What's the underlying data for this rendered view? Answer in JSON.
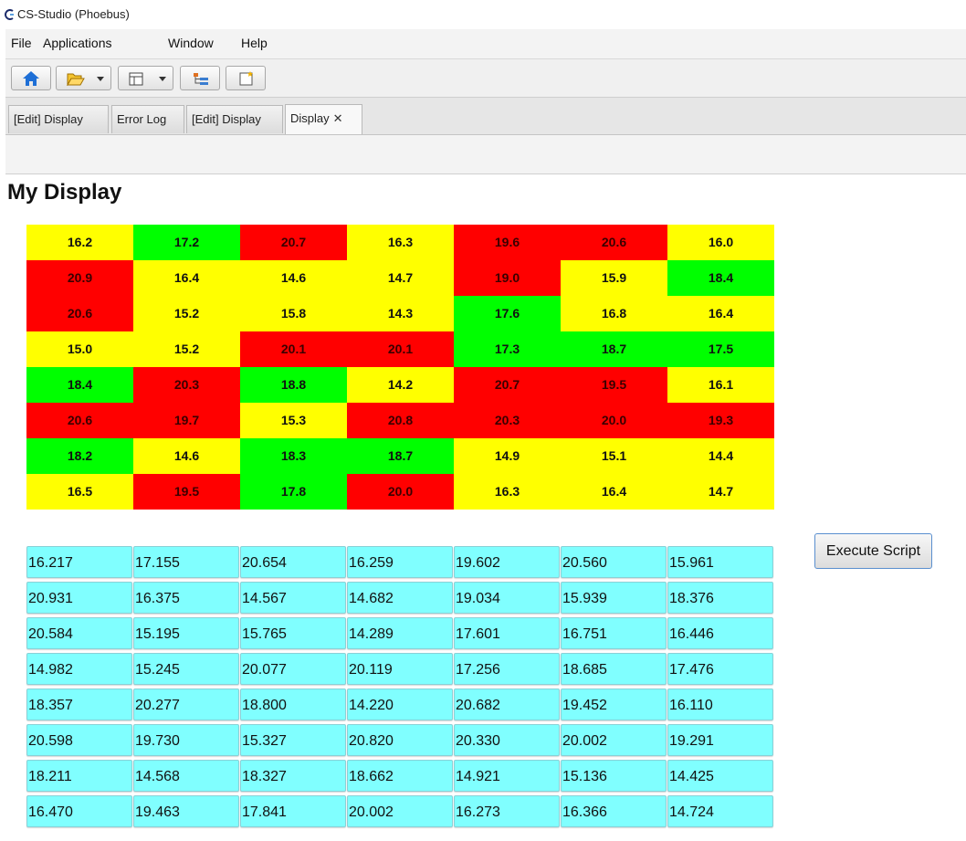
{
  "window": {
    "title": "CS-Studio (Phoebus)"
  },
  "menu": [
    "File",
    "Applications",
    "Window",
    "Help"
  ],
  "toolbar": {
    "buttons": [
      "home-icon",
      "open-folder-icon",
      "layout-icon",
      "tree-icon",
      "new-display-icon"
    ]
  },
  "tabs": [
    {
      "label": "[Edit] Display",
      "active": false
    },
    {
      "label": "Error Log",
      "active": false
    },
    {
      "label": "[Edit] Display",
      "active": false
    },
    {
      "label": "Display",
      "active": true,
      "close": "✕"
    }
  ],
  "display": {
    "title": "My Display",
    "colors": {
      "low": "#ffff00",
      "mid": "#00ff00",
      "high": "#ff0000",
      "text_bg": "#80ffff"
    },
    "colored_grid": [
      [
        [
          "16.2",
          "low"
        ],
        [
          "17.2",
          "mid"
        ],
        [
          "20.7",
          "high"
        ],
        [
          "16.3",
          "low"
        ],
        [
          "19.6",
          "high"
        ],
        [
          "20.6",
          "high"
        ],
        [
          "16.0",
          "low"
        ]
      ],
      [
        [
          "20.9",
          "high"
        ],
        [
          "16.4",
          "low"
        ],
        [
          "14.6",
          "low"
        ],
        [
          "14.7",
          "low"
        ],
        [
          "19.0",
          "high"
        ],
        [
          "15.9",
          "low"
        ],
        [
          "18.4",
          "mid"
        ]
      ],
      [
        [
          "20.6",
          "high"
        ],
        [
          "15.2",
          "low"
        ],
        [
          "15.8",
          "low"
        ],
        [
          "14.3",
          "low"
        ],
        [
          "17.6",
          "mid"
        ],
        [
          "16.8",
          "low"
        ],
        [
          "16.4",
          "low"
        ]
      ],
      [
        [
          "15.0",
          "low"
        ],
        [
          "15.2",
          "low"
        ],
        [
          "20.1",
          "high"
        ],
        [
          "20.1",
          "high"
        ],
        [
          "17.3",
          "mid"
        ],
        [
          "18.7",
          "mid"
        ],
        [
          "17.5",
          "mid"
        ]
      ],
      [
        [
          "18.4",
          "mid"
        ],
        [
          "20.3",
          "high"
        ],
        [
          "18.8",
          "mid"
        ],
        [
          "14.2",
          "low"
        ],
        [
          "20.7",
          "high"
        ],
        [
          "19.5",
          "high"
        ],
        [
          "16.1",
          "low"
        ]
      ],
      [
        [
          "20.6",
          "high"
        ],
        [
          "19.7",
          "high"
        ],
        [
          "15.3",
          "low"
        ],
        [
          "20.8",
          "high"
        ],
        [
          "20.3",
          "high"
        ],
        [
          "20.0",
          "high"
        ],
        [
          "19.3",
          "high"
        ]
      ],
      [
        [
          "18.2",
          "mid"
        ],
        [
          "14.6",
          "low"
        ],
        [
          "18.3",
          "mid"
        ],
        [
          "18.7",
          "mid"
        ],
        [
          "14.9",
          "low"
        ],
        [
          "15.1",
          "low"
        ],
        [
          "14.4",
          "low"
        ]
      ],
      [
        [
          "16.5",
          "low"
        ],
        [
          "19.5",
          "high"
        ],
        [
          "17.8",
          "mid"
        ],
        [
          "20.0",
          "high"
        ],
        [
          "16.3",
          "low"
        ],
        [
          "16.4",
          "low"
        ],
        [
          "14.7",
          "low"
        ]
      ]
    ],
    "text_grid": [
      [
        "16.217",
        "17.155",
        "20.654",
        "16.259",
        "19.602",
        "20.560",
        "15.961"
      ],
      [
        "20.931",
        "16.375",
        "14.567",
        "14.682",
        "19.034",
        "15.939",
        "18.376"
      ],
      [
        "20.584",
        "15.195",
        "15.765",
        "14.289",
        "17.601",
        "16.751",
        "16.446"
      ],
      [
        "14.982",
        "15.245",
        "20.077",
        "20.119",
        "17.256",
        "18.685",
        "17.476"
      ],
      [
        "18.357",
        "20.277",
        "18.800",
        "14.220",
        "20.682",
        "19.452",
        "16.110"
      ],
      [
        "20.598",
        "19.730",
        "15.327",
        "20.820",
        "20.330",
        "20.002",
        "19.291"
      ],
      [
        "18.211",
        "14.568",
        "18.327",
        "18.662",
        "14.921",
        "15.136",
        "14.425"
      ],
      [
        "16.470",
        "19.463",
        "17.841",
        "20.002",
        "16.273",
        "16.366",
        "14.724"
      ]
    ],
    "execute_button": "Execute Script"
  }
}
